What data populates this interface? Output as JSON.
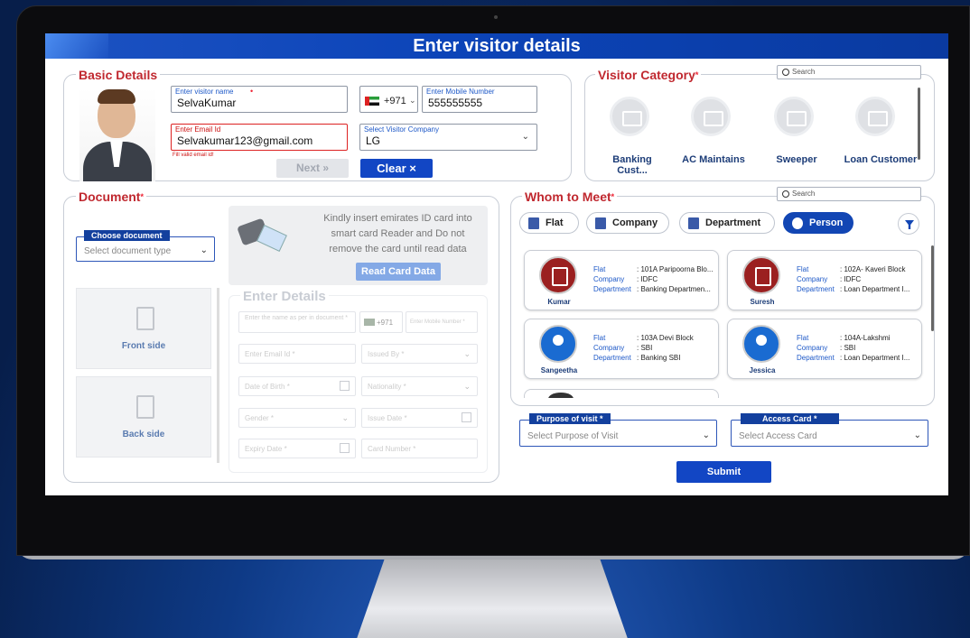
{
  "title": "Enter visitor details",
  "basic": {
    "title": "Basic Details",
    "name_label": "Enter visitor name",
    "name_value": "SelvaKumar",
    "country_code": "+971",
    "mobile_label": "Enter Mobile Number",
    "mobile_value": "555555555",
    "email_label": "Enter Email Id",
    "email_value": "Selvakumar123@gmail.com",
    "email_error": "Fill valid email id!",
    "company_label": "Select Visitor Company",
    "company_value": "LG",
    "next_label": "Next »",
    "clear_label": "Clear ×"
  },
  "visitor_category": {
    "title": "Visitor Category",
    "search_placeholder": "Search",
    "items": [
      "Banking Cust...",
      "AC Maintains",
      "Sweeper",
      "Loan Customer"
    ]
  },
  "document": {
    "title": "Document",
    "choose_label": "Choose document",
    "choose_placeholder": "Select document type",
    "reader_text": "Kindly insert emirates ID card into smart card Reader and Do not remove the card until read data",
    "read_button": "Read Card Data",
    "front_label": "Front side",
    "back_label": "Back side",
    "enter_details_title": "Enter Details",
    "fields": {
      "name": "Enter the name as per in document *",
      "country_code": "+971",
      "mobile": "Enter Mobile Number *",
      "email": "Enter Email Id *",
      "issued_by": "Issued By *",
      "dob": "Date of Birth *",
      "nationality": "Nationality *",
      "gender": "Gender *",
      "issue_date": "Issue Date *",
      "expiry_date": "Expiry Date *",
      "card_number": "Card Number *"
    }
  },
  "whom": {
    "title": "Whom to Meet",
    "search_placeholder": "Search",
    "tabs": [
      "Flat",
      "Company",
      "Department",
      "Person"
    ],
    "active_tab": "Person",
    "keys": {
      "flat": "Flat",
      "company": "Company",
      "department": "Department"
    },
    "cards": [
      {
        "name": "Kumar",
        "bank": "idfc",
        "flat": ": 101A Paripoorna Blo...",
        "company": ": IDFC",
        "department": ": Banking Departmen..."
      },
      {
        "name": "Suresh",
        "bank": "idfc",
        "flat": ": 102A- Kaveri Block",
        "company": ": IDFC",
        "department": ": Loan Department I..."
      },
      {
        "name": "Sangeetha",
        "bank": "sbi",
        "flat": ": 103A Devi Block",
        "company": ": SBI",
        "department": ": Banking SBI"
      },
      {
        "name": "Jessica",
        "bank": "sbi",
        "flat": ": 104A-Lakshmi",
        "company": ": SBI",
        "department": ": Loan Department I..."
      }
    ]
  },
  "purpose": {
    "label": "Purpose of visit *",
    "placeholder": "Select Purpose of Visit"
  },
  "access_card": {
    "label": "Access Card *",
    "placeholder": "Select Access Card"
  },
  "submit_label": "Submit"
}
